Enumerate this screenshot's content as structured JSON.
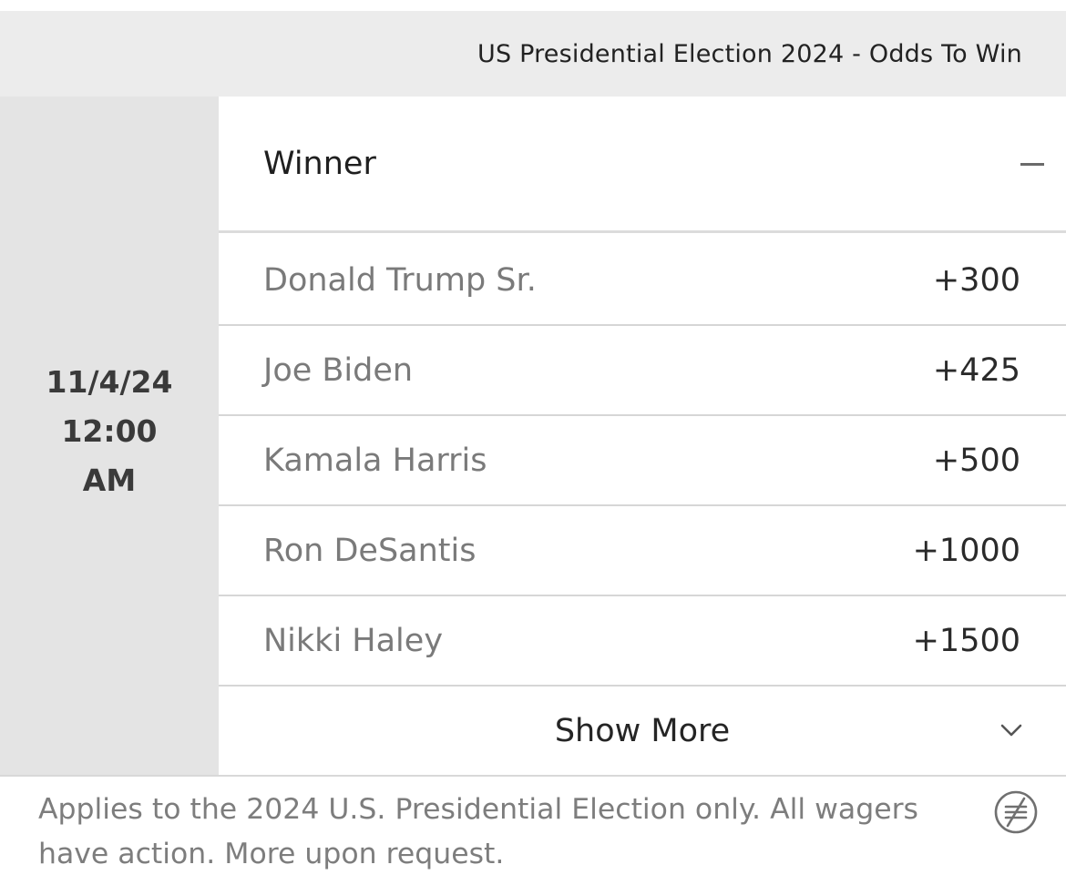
{
  "header": {
    "title": "US Presidential Election 2024 - Odds To Win"
  },
  "event": {
    "date": "11/4/24",
    "time": "12:00",
    "ampm": "AM"
  },
  "market": {
    "title": "Winner",
    "collapse_icon": "minus-icon",
    "selections": [
      {
        "name": "Donald Trump Sr.",
        "odds": "+300"
      },
      {
        "name": "Joe Biden",
        "odds": "+425"
      },
      {
        "name": "Kamala Harris",
        "odds": "+500"
      },
      {
        "name": "Ron DeSantis",
        "odds": "+1000"
      },
      {
        "name": "Nikki Haley",
        "odds": "+1500"
      }
    ],
    "show_more_label": "Show More",
    "show_more_icon": "chevron-down-icon"
  },
  "footer": {
    "note": "Applies to the 2024 U.S. Presidential Election only. All wagers have action. More upon request.",
    "icon": "no-parlay-icon"
  },
  "colors": {
    "header_bg": "#ececec",
    "left_col_bg": "#e4e4e4",
    "name_text": "#7a7a7a",
    "odds_text": "#2a2a2a"
  }
}
